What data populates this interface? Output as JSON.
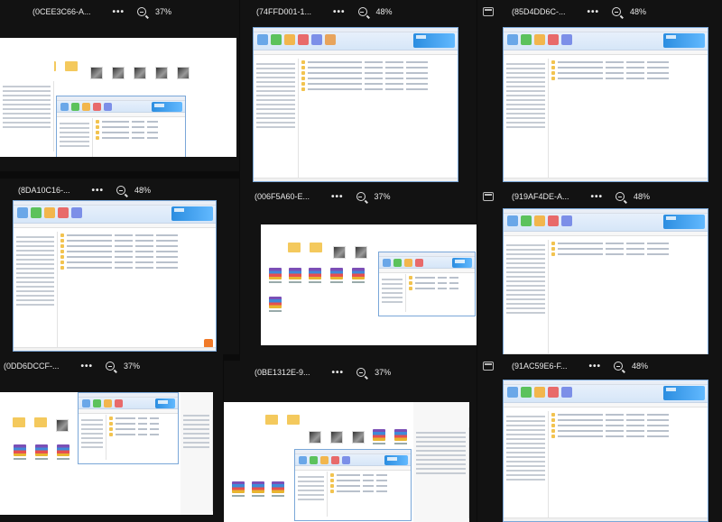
{
  "tiles": [
    {
      "id": "(0CEE3C66-A...",
      "zoom": "37%"
    },
    {
      "id": "(74FFD001-1...",
      "zoom": "48%"
    },
    {
      "id": "(85D4DD6C-...",
      "zoom": "48%"
    },
    {
      "id": "(8DA10C16-...",
      "zoom": "48%"
    },
    {
      "id": "(006F5A60-E...",
      "zoom": "37%"
    },
    {
      "id": "(919AF4DE-A...",
      "zoom": "48%"
    },
    {
      "id": "(0DD6DCCF-...",
      "zoom": "37%"
    },
    {
      "id": "(0BE1312E-9...",
      "zoom": "37%"
    },
    {
      "id": "(91AC59E6-F...",
      "zoom": "48%"
    }
  ],
  "menu_dots": "•••",
  "icons": {
    "window": "window-icon",
    "zoom": "zoom-in-icon",
    "menu": "more-options-icon"
  },
  "colors": {
    "background": "#0b0b0b",
    "header_text": "#e8e8e8",
    "explorer_border": "#7aa7d8"
  }
}
